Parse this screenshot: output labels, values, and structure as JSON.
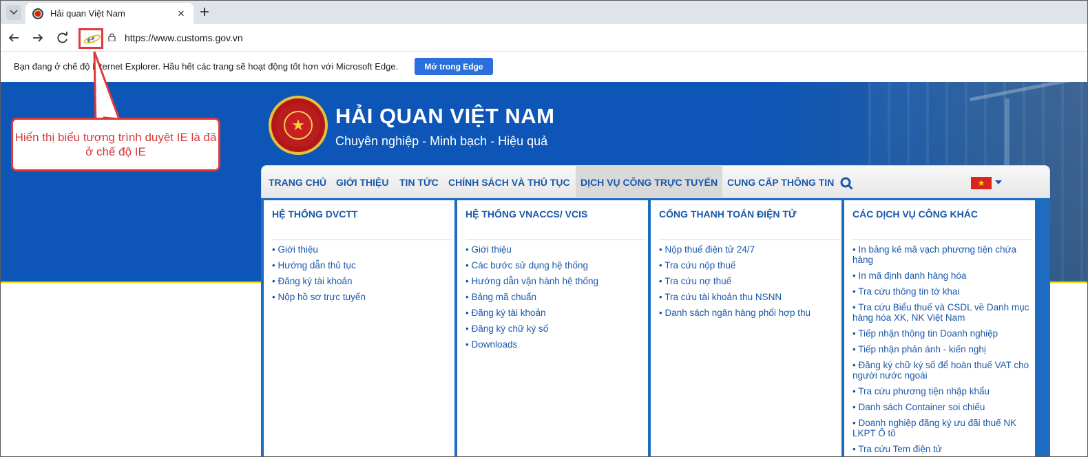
{
  "browser": {
    "tab_title": "Hải quan Việt Nam",
    "url": "https://www.customs.gov.vn",
    "icons": [
      "tab-menu-icon",
      "close-icon",
      "plus-icon",
      "back-icon",
      "forward-icon",
      "refresh-icon",
      "ie-mode-icon",
      "lock-icon"
    ]
  },
  "infobar": {
    "message": "Bạn đang ở chế độ Internet Explorer. Hầu hết các trang sẽ hoạt động tốt hơn với Microsoft Edge.",
    "button_label": "Mở trong Edge"
  },
  "callout": {
    "text": "Hiển thị biểu tượng trình duyệt IE là đã ở chế độ IE"
  },
  "site": {
    "title": "HẢI QUAN VIỆT NAM",
    "subtitle": "Chuyên nghiệp - Minh bạch - Hiệu quả",
    "menu": [
      {
        "label": "TRANG CHỦ",
        "active": false
      },
      {
        "label": "GIỚI THIỆU",
        "active": false
      },
      {
        "label": "TIN TỨC",
        "active": false
      },
      {
        "label": "CHÍNH SÁCH VÀ THỦ TỤC",
        "active": false
      },
      {
        "label": "DỊCH VỤ CÔNG TRỰC TUYẾN",
        "active": true
      },
      {
        "label": "CUNG CẤP THÔNG TIN",
        "active": false
      }
    ],
    "icons": [
      "search-icon",
      "vietnam-flag-icon",
      "chevron-down-icon",
      "customs-emblem-icon"
    ],
    "columns": [
      {
        "title": "HỆ THỐNG DVCTT",
        "links": [
          "Giới thiệu",
          "Hướng dẫn thủ tục",
          "Đăng ký tài khoản",
          "Nộp hồ sơ trực tuyến"
        ]
      },
      {
        "title": "HỆ THỐNG VNACCS/ VCIS",
        "links": [
          "Giới thiệu",
          "Các bước sử dụng hệ thống",
          "Hướng dẫn vận hành hệ thống",
          "Bảng mã chuẩn",
          "Đăng ký tài khoản",
          "Đăng ký chữ ký số",
          "Downloads"
        ]
      },
      {
        "title": "CỔNG THANH TOÁN ĐIỆN TỬ",
        "links": [
          "Nộp thuế điện tử 24/7",
          "Tra cứu nộp thuế",
          "Tra cứu nợ thuế",
          "Tra cứu tài khoản thu NSNN",
          "Danh sách ngân hàng phối hợp thu"
        ]
      },
      {
        "title": "CÁC DỊCH VỤ CÔNG KHÁC",
        "links": [
          "In bảng kê mã vạch phương tiện chứa hàng",
          "In mã định danh hàng hóa",
          "Tra cứu thông tin tờ khai",
          "Tra cứu Biểu thuế và CSDL về Danh mục hàng hóa XK, NK Việt Nam",
          "Tiếp nhận thông tin Doanh nghiệp",
          "Tiếp nhận phản ánh - kiến nghị",
          "Đăng ký chữ ký số để hoàn thuế VAT cho người nước ngoài",
          "Tra cứu phương tiện nhập khẩu",
          "Danh sách Container soi chiếu",
          "Doanh nghiệp đăng ký ưu đãi thuế NK LKPT Ô tô",
          "Tra cứu Tem điện tử"
        ]
      }
    ]
  }
}
